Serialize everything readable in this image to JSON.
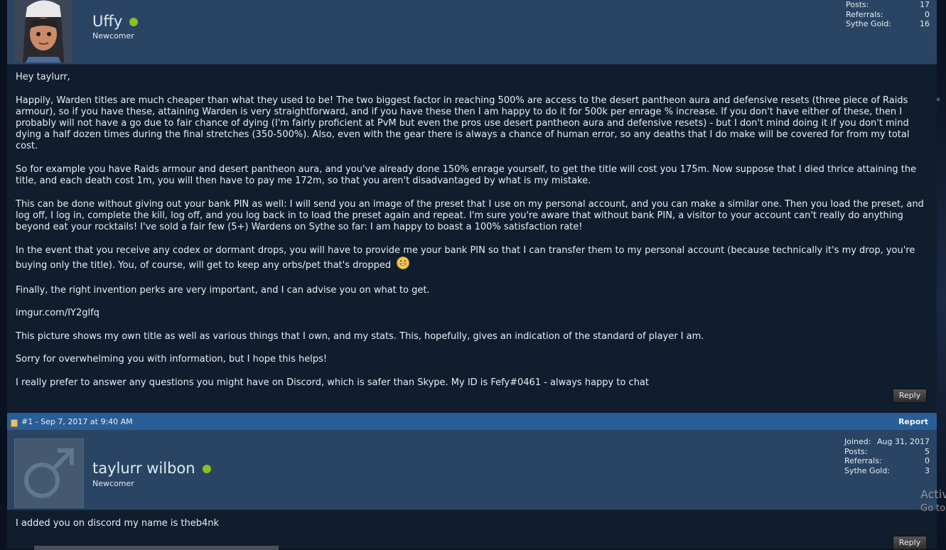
{
  "post1": {
    "username": "Uffy",
    "rank": "Newcomer",
    "stats": [
      {
        "label": "Posts:",
        "value": "17"
      },
      {
        "label": "Referrals:",
        "value": "0"
      },
      {
        "label": "Sythe Gold:",
        "value": "16"
      }
    ],
    "paragraphs": [
      "Hey taylurr,",
      "Happily, Warden titles are much cheaper than what they used to be! The two biggest factor in reaching 500% are access to the desert pantheon aura and defensive resets (three piece of Raids armour), so if you have these, attaining Warden is very straightforward, and if you have these then I am happy to do it for 500k per enrage % increase. If you don't have either of these, then I probably will not have a go due to fair chance of dying (I'm fairly proficient at PvM but even the pros use desert pantheon aura and defensive resets) - but I don't mind doing it if you don't mind dying a half dozen times during the final stretches (350-500%). Also, even with the gear there is always a chance of human error, so any deaths that I do make will be covered for from my total cost.",
      "So for example you have Raids armour and desert pantheon aura, and you've already done 150% enrage yourself, to get the title will cost you 175m. Now suppose that I died thrice attaining the title, and each death cost 1m, you will then have to pay me 172m, so that you aren't disadvantaged by what is my mistake.",
      "This can be done without giving out your bank PIN as well: I will send you an image of the preset that I use on my personal account, and you can make a similar one. Then you load the preset, and log off, I log in, complete the kill, log off, and you log back in to load the preset again and repeat. I'm sure you're aware that without bank PIN, a visitor to your account can't really do anything beyond eat your rocktails! I've sold a fair few (5+) Wardens on Sythe so far: I am happy to boast a 100% satisfaction rate!",
      "In the event that you receive any codex or dormant drops, you will have to provide me your bank PIN so that I can transfer them to my personal account (because technically it's my drop, you're buying only the title). You, of course, will get to keep any orbs/pet that's dropped",
      "Finally, the right invention perks are very important, and I can advise you on what to get.",
      "imgur.com/IY2glfq",
      "This picture shows my own title as well as various things that I own, and my stats. This, hopefully, gives an indication of the standard of player I am.",
      "Sorry for overwhelming you with information, but I hope this helps!",
      "I really prefer to answer any questions you might have on Discord, which is safer than Skype. My ID is Fefy#0461 - always happy to chat"
    ],
    "reply_label": "Reply"
  },
  "meta": {
    "post_number": "#1 - Sep 7, 2017 at 9:40 AM",
    "report_label": "Report"
  },
  "post2": {
    "username": "taylurr wilbon",
    "rank": "Newcomer",
    "stats": [
      {
        "label": "Joined:",
        "value": "Aug 31, 2017"
      },
      {
        "label": "Posts:",
        "value": "5"
      },
      {
        "label": "Referrals:",
        "value": "0"
      },
      {
        "label": "Sythe Gold:",
        "value": "3"
      }
    ],
    "text": "I added you on discord my name is theb4nk",
    "reply_label": "Reply"
  },
  "overlay": {
    "activate": "Activ",
    "goto": "Go to"
  },
  "colors": {
    "online": "#8cc021",
    "header_bg": "#2a4563",
    "meta_bg": "#2a5e96",
    "body_bg": "#0f1d2e"
  }
}
